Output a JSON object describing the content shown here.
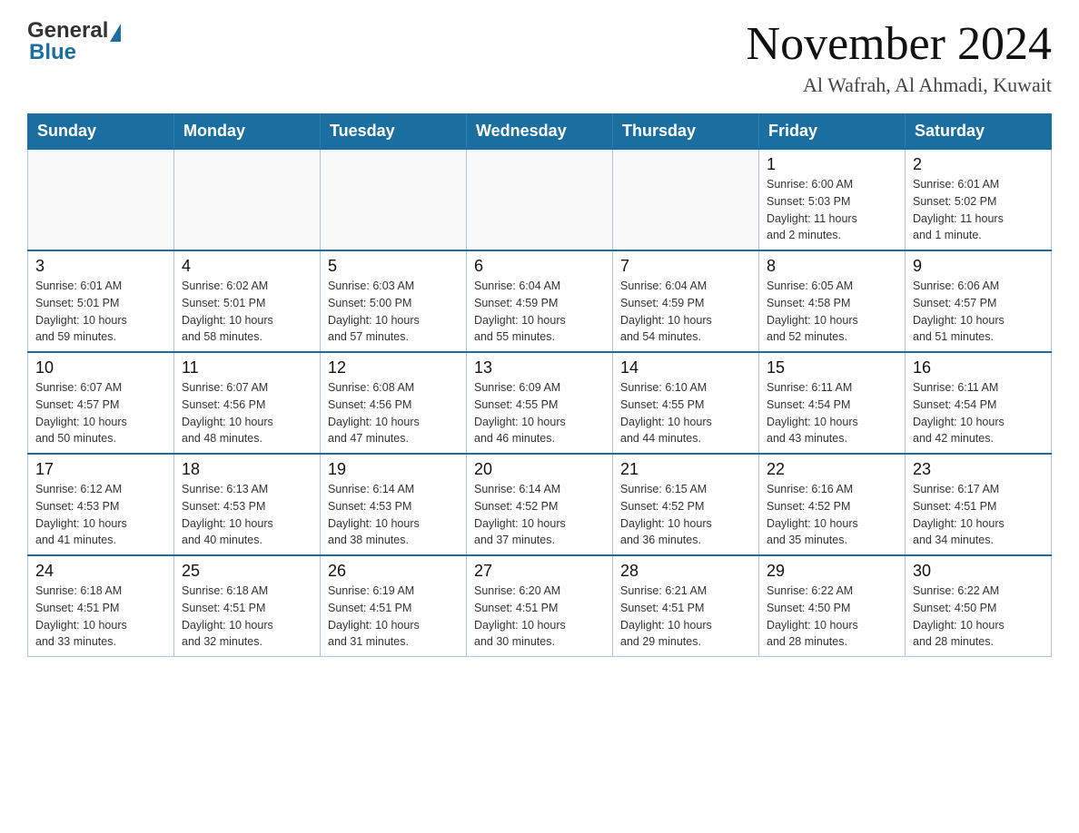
{
  "header": {
    "logo_general": "General",
    "logo_blue": "Blue",
    "month_title": "November 2024",
    "location": "Al Wafrah, Al Ahmadi, Kuwait"
  },
  "days_of_week": [
    "Sunday",
    "Monday",
    "Tuesday",
    "Wednesday",
    "Thursday",
    "Friday",
    "Saturday"
  ],
  "weeks": [
    [
      {
        "day": "",
        "info": ""
      },
      {
        "day": "",
        "info": ""
      },
      {
        "day": "",
        "info": ""
      },
      {
        "day": "",
        "info": ""
      },
      {
        "day": "",
        "info": ""
      },
      {
        "day": "1",
        "info": "Sunrise: 6:00 AM\nSunset: 5:03 PM\nDaylight: 11 hours\nand 2 minutes."
      },
      {
        "day": "2",
        "info": "Sunrise: 6:01 AM\nSunset: 5:02 PM\nDaylight: 11 hours\nand 1 minute."
      }
    ],
    [
      {
        "day": "3",
        "info": "Sunrise: 6:01 AM\nSunset: 5:01 PM\nDaylight: 10 hours\nand 59 minutes."
      },
      {
        "day": "4",
        "info": "Sunrise: 6:02 AM\nSunset: 5:01 PM\nDaylight: 10 hours\nand 58 minutes."
      },
      {
        "day": "5",
        "info": "Sunrise: 6:03 AM\nSunset: 5:00 PM\nDaylight: 10 hours\nand 57 minutes."
      },
      {
        "day": "6",
        "info": "Sunrise: 6:04 AM\nSunset: 4:59 PM\nDaylight: 10 hours\nand 55 minutes."
      },
      {
        "day": "7",
        "info": "Sunrise: 6:04 AM\nSunset: 4:59 PM\nDaylight: 10 hours\nand 54 minutes."
      },
      {
        "day": "8",
        "info": "Sunrise: 6:05 AM\nSunset: 4:58 PM\nDaylight: 10 hours\nand 52 minutes."
      },
      {
        "day": "9",
        "info": "Sunrise: 6:06 AM\nSunset: 4:57 PM\nDaylight: 10 hours\nand 51 minutes."
      }
    ],
    [
      {
        "day": "10",
        "info": "Sunrise: 6:07 AM\nSunset: 4:57 PM\nDaylight: 10 hours\nand 50 minutes."
      },
      {
        "day": "11",
        "info": "Sunrise: 6:07 AM\nSunset: 4:56 PM\nDaylight: 10 hours\nand 48 minutes."
      },
      {
        "day": "12",
        "info": "Sunrise: 6:08 AM\nSunset: 4:56 PM\nDaylight: 10 hours\nand 47 minutes."
      },
      {
        "day": "13",
        "info": "Sunrise: 6:09 AM\nSunset: 4:55 PM\nDaylight: 10 hours\nand 46 minutes."
      },
      {
        "day": "14",
        "info": "Sunrise: 6:10 AM\nSunset: 4:55 PM\nDaylight: 10 hours\nand 44 minutes."
      },
      {
        "day": "15",
        "info": "Sunrise: 6:11 AM\nSunset: 4:54 PM\nDaylight: 10 hours\nand 43 minutes."
      },
      {
        "day": "16",
        "info": "Sunrise: 6:11 AM\nSunset: 4:54 PM\nDaylight: 10 hours\nand 42 minutes."
      }
    ],
    [
      {
        "day": "17",
        "info": "Sunrise: 6:12 AM\nSunset: 4:53 PM\nDaylight: 10 hours\nand 41 minutes."
      },
      {
        "day": "18",
        "info": "Sunrise: 6:13 AM\nSunset: 4:53 PM\nDaylight: 10 hours\nand 40 minutes."
      },
      {
        "day": "19",
        "info": "Sunrise: 6:14 AM\nSunset: 4:53 PM\nDaylight: 10 hours\nand 38 minutes."
      },
      {
        "day": "20",
        "info": "Sunrise: 6:14 AM\nSunset: 4:52 PM\nDaylight: 10 hours\nand 37 minutes."
      },
      {
        "day": "21",
        "info": "Sunrise: 6:15 AM\nSunset: 4:52 PM\nDaylight: 10 hours\nand 36 minutes."
      },
      {
        "day": "22",
        "info": "Sunrise: 6:16 AM\nSunset: 4:52 PM\nDaylight: 10 hours\nand 35 minutes."
      },
      {
        "day": "23",
        "info": "Sunrise: 6:17 AM\nSunset: 4:51 PM\nDaylight: 10 hours\nand 34 minutes."
      }
    ],
    [
      {
        "day": "24",
        "info": "Sunrise: 6:18 AM\nSunset: 4:51 PM\nDaylight: 10 hours\nand 33 minutes."
      },
      {
        "day": "25",
        "info": "Sunrise: 6:18 AM\nSunset: 4:51 PM\nDaylight: 10 hours\nand 32 minutes."
      },
      {
        "day": "26",
        "info": "Sunrise: 6:19 AM\nSunset: 4:51 PM\nDaylight: 10 hours\nand 31 minutes."
      },
      {
        "day": "27",
        "info": "Sunrise: 6:20 AM\nSunset: 4:51 PM\nDaylight: 10 hours\nand 30 minutes."
      },
      {
        "day": "28",
        "info": "Sunrise: 6:21 AM\nSunset: 4:51 PM\nDaylight: 10 hours\nand 29 minutes."
      },
      {
        "day": "29",
        "info": "Sunrise: 6:22 AM\nSunset: 4:50 PM\nDaylight: 10 hours\nand 28 minutes."
      },
      {
        "day": "30",
        "info": "Sunrise: 6:22 AM\nSunset: 4:50 PM\nDaylight: 10 hours\nand 28 minutes."
      }
    ]
  ]
}
